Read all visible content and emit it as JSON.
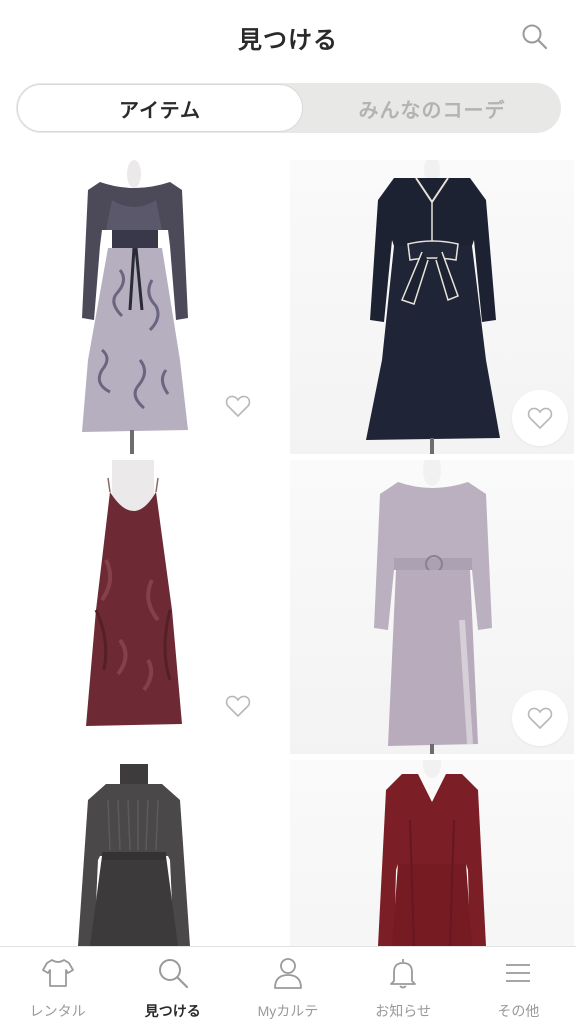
{
  "header": {
    "title": "見つける",
    "search_icon": "search-icon"
  },
  "segment": {
    "items": [
      "アイテム",
      "みんなのコーデ"
    ],
    "selected": "アイテム"
  },
  "items": [
    {
      "name": "lavender-tulle-dress",
      "favorite_icon": "heart-outline-icon",
      "colors": {
        "top": "#4c4a58",
        "skirt": "#b6afc0",
        "print": "#6b6680"
      }
    },
    {
      "name": "navy-bow-dress",
      "favorite_icon": "heart-outline-icon",
      "colors": {
        "body": "#1d2233",
        "piping": "#e8e3d9"
      }
    },
    {
      "name": "bordeaux-velvet-camisole-dress",
      "favorite_icon": "heart-outline-icon",
      "colors": {
        "body": "#6e2a34"
      }
    },
    {
      "name": "lilac-belted-dress",
      "favorite_icon": "heart-outline-icon",
      "colors": {
        "body": "#bbb0c0"
      }
    },
    {
      "name": "charcoal-pleated-dress",
      "favorite_icon": "heart-outline-icon",
      "colors": {
        "body": "#4b4849"
      }
    },
    {
      "name": "wine-v-neck-dress",
      "favorite_icon": "heart-outline-icon",
      "colors": {
        "body": "#7c1e25"
      }
    }
  ],
  "tabbar": {
    "items": [
      {
        "label": "レンタル",
        "icon": "shirt-icon"
      },
      {
        "label": "見つける",
        "icon": "search-icon"
      },
      {
        "label": "Myカルテ",
        "icon": "person-icon"
      },
      {
        "label": "お知らせ",
        "icon": "bell-icon"
      },
      {
        "label": "その他",
        "icon": "menu-icon"
      }
    ],
    "active": "見つける"
  }
}
